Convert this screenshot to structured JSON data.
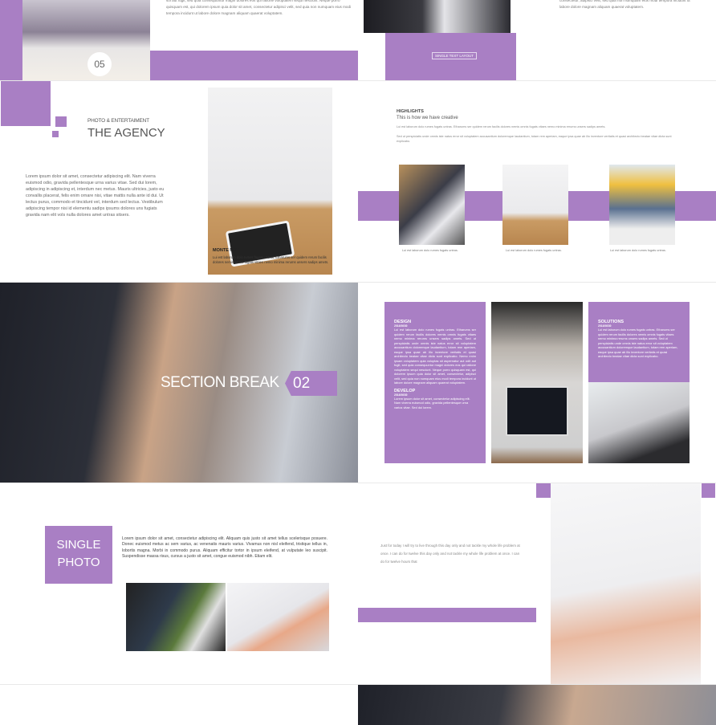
{
  "colors": {
    "accent": "#a97fc4",
    "background": "#ffffff"
  },
  "slide1": {
    "number": "05",
    "text": "sol aut fugit, sed quia consequuntur magni dolores eos qui ratione voluptatem sequi nesciunt. Neque porro quisquam est, qui dolorem ipsum quia dolor sit amet, consectetur adipisci velit, sed quia non numquam eius modi tempora incidunt ut labore dolore magnam aliquam quaerat voluptatem."
  },
  "slide2": {
    "button": "SINGLE TEXT LAYOUT",
    "text": "consectetur, adipisci velit, sed quia non numquam eius modi tempora incidunt ut labore dolore magnam aliquam quaerat voluptatem."
  },
  "agency": {
    "kicker": "PHOTO & ENTERTAIMENT",
    "title": "THE AGENCY",
    "body": "Lorem ipsum dolor sit amet, consectetur adipiscing elit. Nam viverra euismod odio, gravida pellentesque urna varius vitae. Sed dui lorem, adipiscing in adipiscing et, interdum nec metus. Mauris ultricies, justo eu convallis placerat, felis enim ornare nisi, vitae mattis nulla ante id dui. Ut lectus purus, commodo et tincidunt vel, interdum sed lectus. Vestibulum adipiscing tempor nisi id elementu sadips ipsums dolores uns fugiats gravida nam elit vols nulla dolores amet untras sitsers.",
    "note_title": "MONTE NOTE",
    "note_text": "Lui est laborum dolo rumes fugats untras. Etharums ser quidem rerum facilis dolores nemis omnis fugats vitaes nemo minima rerums unsers sadips amets."
  },
  "highlights": {
    "title": "HIGHLIGHTS",
    "subtitle": "This is how we have creative",
    "p1": "Lui est laborum dolo rumes fugats untras. Etharums ser quidem rerum facilis dolores nemis omnis fugats vitaes nemo minima rerums unsers sadips amets.",
    "p2": "Sed ut perspiciatis unde omnis iste natus error sit voluptatem accusantium doloremque laudantium, totam rem aperiam, eaque ipsa quae ab illo inventore veritatis et quasi architecto beatae vitae dicta sunt explicabo.",
    "captions": [
      "Lui est laborum dolo rumes fugats untras.",
      "Lui est laborum dolo rumes fugats untras.",
      "Lui est laborum dolo rumes fugats untras."
    ]
  },
  "section": {
    "title": "SECTION BREAK",
    "number": "02"
  },
  "design": {
    "h1": "DESIGN",
    "d1": "2014/06/30",
    "t1": "Lui est laborum dolo rumes fugats untras. Etharums ser quidem rerum facilis dolores nemis omnis fugats vitaes nemo minima rerums unsers sadips amets. Sed ut perspiciatis unde omnis iste natus error sit voluptatem accusantium doloremque laudantium, totam rem aperiam, eaque ipsa quae ab illo inventore veritatis et quasi architecto beatae vitae dicta sunt explicabo. Nemo enim ipsam voluptatem quia voluptas sit aspernatur aut odit aut fugit, sed quia consequuntur magni dolores eos qui ratione voluptatem sequi nesciunt. Neque porro quisquam est, qui dolorem ipsum quia dolor sit amet, consectetur, adipisci velit, sed quia non numquam eius modi tempora incidunt ut labore dolore magnam aliquam quaerat voluptatem.",
    "h2": "DEVELOP",
    "d2": "2014/06/30",
    "t2": "Lorem ipsum dolor sit amet, consectetur adipiscing elit. Nam viverra euismod odio, gravida pellentesque urna varius vitae. Sed dui lorem.",
    "h3": "SOLUTIONS",
    "d3": "2014/06/30",
    "t3": "Lui est laborum dolo rumes fugats untras. Etharums ser quidem rerum facilis dolores nemis omnis fugats vitaes nemo minima rerums unsers sadips amets. Sed ut perspiciatis unde omnis iste natus error sit voluptatem accusantium doloremque laudantium, totam rem aperiam, eaque ipsa quae ab illo inventore veritatis et quasi architecto beatae vitae dicta sunt explicabo."
  },
  "single": {
    "line1": "SINGLE",
    "line2": "PHOTO",
    "body": "Lorem ipsum dolor sit amet, consectetur adipiscing elit. Aliquam quis justo sit amet tellus scelerisque posuere. Donec euismod metus ac sem varius, ac venenatis mauris varius. Vivamus non nisl eleifend, tristique tellus in, lobortis magna. Morbi in commodo purus. Aliquam efficitur tortor in ipsum eleifend, at vulputate leo suscipit. Suspendisse massa risus, cursus a justo sit amet, congue euismod nibh. Etiam elit."
  },
  "quote": {
    "text": "Just for today I will try to live through this day only and not tackle my whole life problem at once. I can do for twelve this day only and not tackle my whole life problem at once. I can do for twelve hours that"
  }
}
